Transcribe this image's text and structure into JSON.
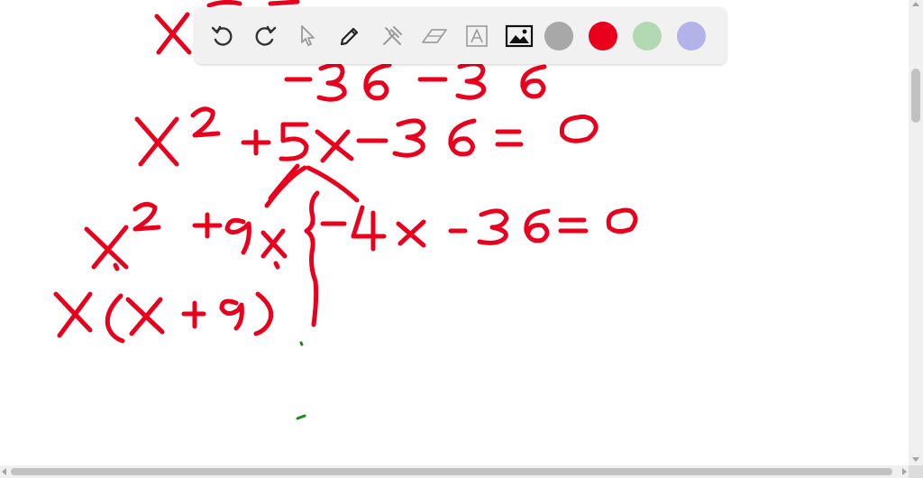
{
  "toolbar": {
    "tools": [
      {
        "name": "undo-icon",
        "enabled": true
      },
      {
        "name": "redo-icon",
        "enabled": true
      },
      {
        "name": "pointer-icon",
        "enabled": false
      },
      {
        "name": "pen-icon",
        "enabled": true
      },
      {
        "name": "tools-icon",
        "enabled": false
      },
      {
        "name": "eraser-icon",
        "enabled": false
      },
      {
        "name": "text-icon",
        "enabled": false
      },
      {
        "name": "image-icon",
        "enabled": true
      }
    ],
    "colors": [
      "#a8a8a8",
      "#e8001c",
      "#b3d9b3",
      "#b3b3ea"
    ],
    "selected_color": "#e8001c"
  },
  "canvas": {
    "ink_colors": {
      "primary": "#e8001c",
      "secondary": "#1b8a1b"
    }
  }
}
